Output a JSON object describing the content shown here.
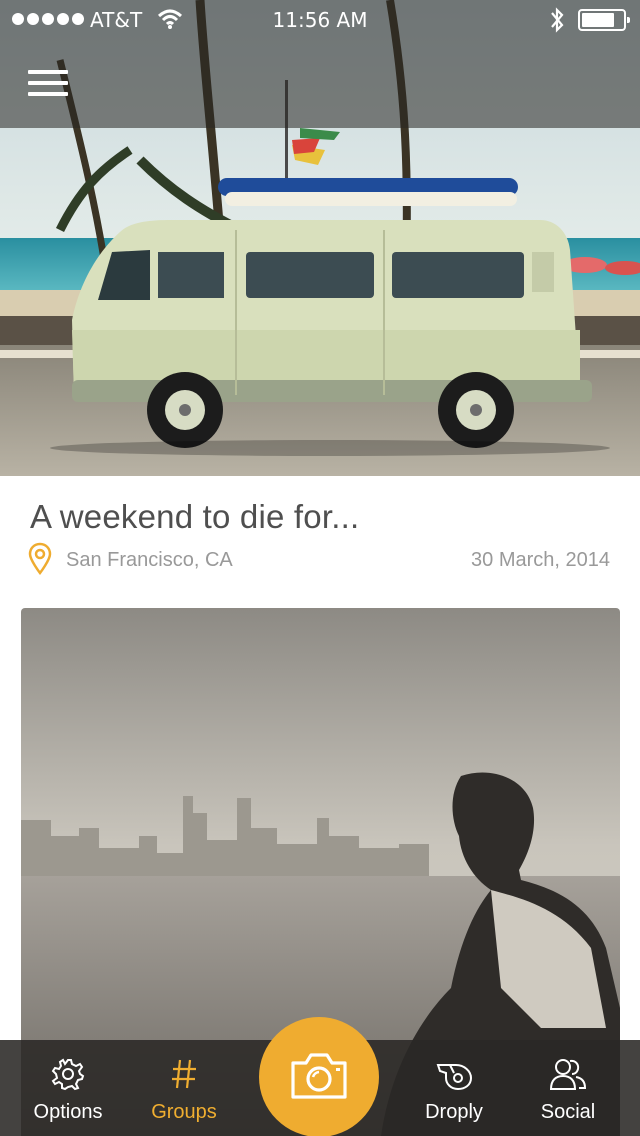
{
  "status_bar": {
    "carrier": "AT&T",
    "time": "11:56 AM",
    "battery_level": 0.8
  },
  "header": {
    "menu_icon": "hamburger-menu-icon"
  },
  "post": {
    "title": "A weekend to die for...",
    "location": "San Francisco, CA",
    "date": "30 March, 2014",
    "location_icon": "map-pin-icon"
  },
  "tabbar": {
    "items": [
      {
        "label": "Options",
        "icon": "gear-icon"
      },
      {
        "label": "Groups",
        "icon": "hashtag-icon",
        "active": true
      },
      {
        "label": "Droply",
        "icon": "whistle-icon"
      },
      {
        "label": "Social",
        "icon": "users-icon"
      }
    ],
    "camera_icon": "camera-icon"
  },
  "colors": {
    "accent": "#efac30",
    "text_dark": "#4f4f4f",
    "text_muted": "#999999",
    "bar_bg": "#2a2825"
  }
}
